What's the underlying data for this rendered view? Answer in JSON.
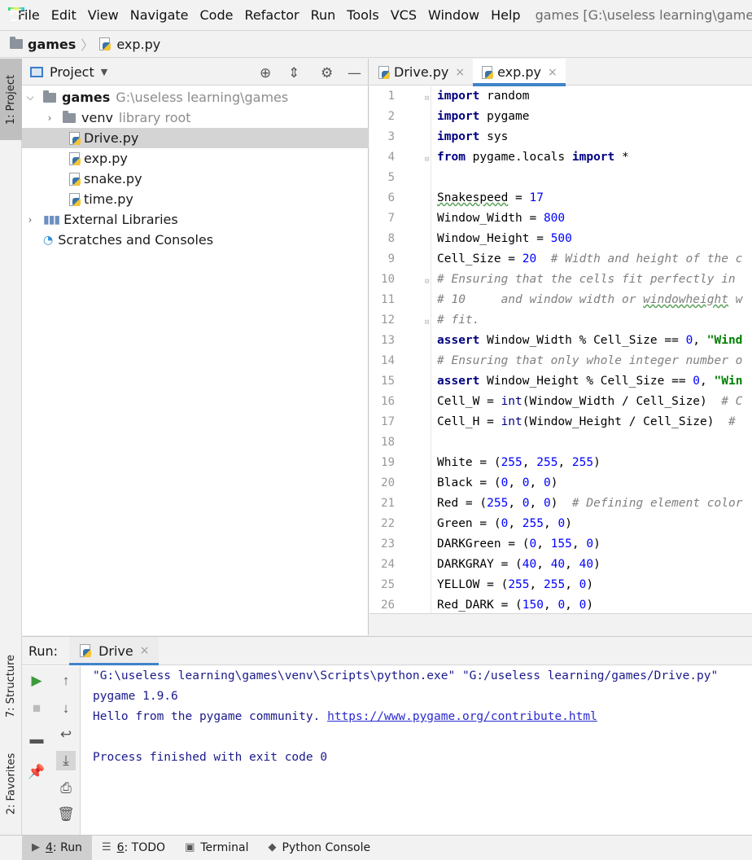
{
  "menubar": {
    "items": [
      "File",
      "Edit",
      "View",
      "Navigate",
      "Code",
      "Refactor",
      "Run",
      "Tools",
      "VCS",
      "Window",
      "Help"
    ],
    "title": "games [G:\\useless learning\\games]"
  },
  "breadcrumb": {
    "project": "games",
    "file": "exp.py"
  },
  "left_stripe": {
    "project_tab": "1: Project",
    "structure_tab": "7: Structure",
    "favorites_tab": "2: Favorites"
  },
  "project_panel": {
    "title": "Project",
    "tree": [
      {
        "label": "games",
        "detail": "G:\\useless learning\\games"
      },
      {
        "label": "venv",
        "detail": "library root"
      },
      {
        "label": "Drive.py"
      },
      {
        "label": "exp.py"
      },
      {
        "label": "snake.py"
      },
      {
        "label": "time.py"
      },
      {
        "label": "External Libraries"
      },
      {
        "label": "Scratches and Consoles"
      }
    ]
  },
  "editor": {
    "tabs": [
      {
        "label": "Drive.py",
        "close": "×"
      },
      {
        "label": "exp.py",
        "close": "×"
      }
    ],
    "line_numbers": [
      "1",
      "2",
      "3",
      "4",
      "5",
      "6",
      "7",
      "8",
      "9",
      "10",
      "11",
      "12",
      "13",
      "14",
      "15",
      "16",
      "17",
      "18",
      "19",
      "20",
      "21",
      "22",
      "23",
      "24",
      "25",
      "26"
    ],
    "code": {
      "import": "import",
      "from": "from",
      "assert": "assert",
      "int": "int",
      "l1_mod": " random",
      "l2_mod": " pygame",
      "l3_mod": " sys",
      "l4_mod": " pygame.locals ",
      "l4_star": " *",
      "l6_name": "Snakespeed",
      "l6_eq": " = ",
      "l6_val": "17",
      "l7_pre": "Window_Width = ",
      "l7_val": "800",
      "l8_pre": "Window_Height = ",
      "l8_val": "500",
      "l9_pre": "Cell_Size = ",
      "l9_val": "20",
      "l9_cmt": "  # Width and height of the c",
      "l10": "# Ensuring that the cells fit perfectly in",
      "l11_a": "# 10     and window width or ",
      "l11_b": "windowheight",
      "l11_c": " w",
      "l12": "# fit.",
      "l13_mid": " Window_Width % Cell_Size == ",
      "l13_zero": "0",
      "l13_comma": ", ",
      "l13_str": "\"Wind",
      "l14": "# Ensuring that only whole integer number o",
      "l15_mid": " Window_Height % Cell_Size == ",
      "l15_zero": "0",
      "l15_comma": ", ",
      "l15_str": "\"Win",
      "l16_pre": "Cell_W = ",
      "l16_mid": "(Window_Width / Cell_Size)",
      "l16_cmt": "  # C",
      "l17_pre": "Cell_H = ",
      "l17_mid": "(Window_Height / Cell_Size)",
      "l17_cmt": "  #",
      "l19_pre": "White = (",
      "l19_a": "255",
      "l19_b": "255",
      "l19_c": "255",
      "l20_pre": "Black = (",
      "l20_a": "0",
      "l20_b": "0",
      "l20_c": "0",
      "l21_pre": "Red = (",
      "l21_a": "255",
      "l21_b": "0",
      "l21_c": "0",
      "l21_cmt": "  # Defining element color",
      "l22_pre": "Green = (",
      "l22_a": "0",
      "l22_b": "255",
      "l22_c": "0",
      "l23_pre": "DARKGreen = (",
      "l23_a": "0",
      "l23_b": "155",
      "l23_c": "0",
      "l24_pre": "DARKGRAY = (",
      "l24_a": "40",
      "l24_b": "40",
      "l24_c": "40",
      "l25_pre": "YELLOW = (",
      "l25_a": "255",
      "l25_b": "255",
      "l25_c": "0",
      "l26_pre": "Red_DARK = (",
      "l26_a": "150",
      "l26_b": "0",
      "l26_c": "0",
      "sep": ", ",
      "close": ")"
    }
  },
  "run_panel": {
    "label": "Run:",
    "tab": "Drive",
    "tab_close": "×",
    "console": {
      "line1": "\"G:\\useless learning\\games\\venv\\Scripts\\python.exe\" \"G:/useless learning/games/Drive.py\"",
      "line2": "pygame 1.9.6",
      "line3_text": "Hello from the pygame community. ",
      "line3_link": "https://www.pygame.org/contribute.html",
      "line5": "Process finished with exit code 0"
    }
  },
  "bottom_bar": {
    "items": [
      {
        "num": "4",
        "label": ": Run"
      },
      {
        "num": "6",
        "label": ": TODO"
      },
      {
        "label": "Terminal"
      },
      {
        "label": "Python Console"
      }
    ]
  },
  "colors": {
    "keyword": "#000080",
    "number": "#0000ff",
    "string": "#008000",
    "comment": "#808080",
    "accent": "#4083c9",
    "console_text": "#1a1a8c"
  }
}
